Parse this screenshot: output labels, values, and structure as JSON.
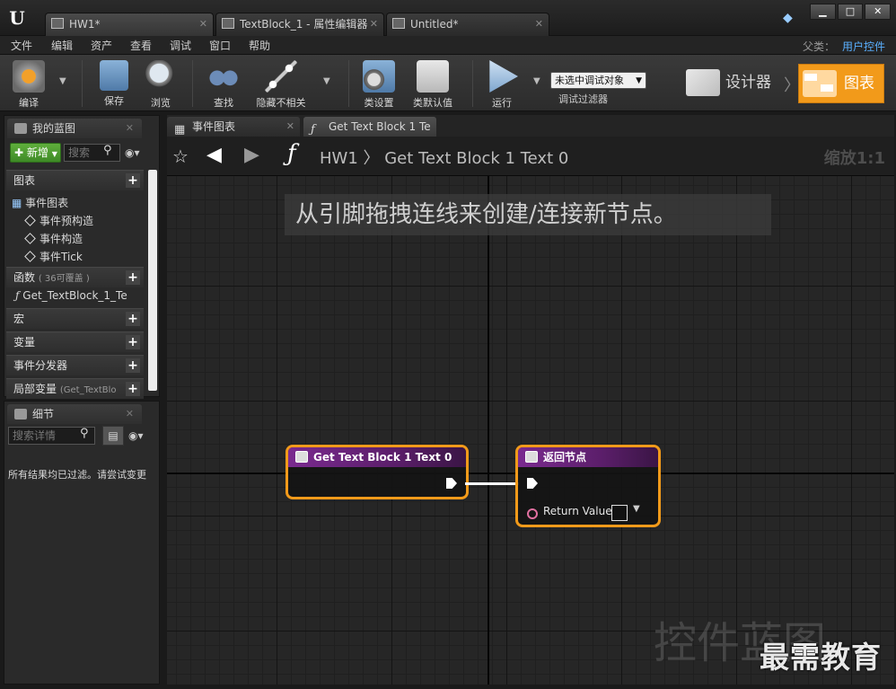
{
  "window": {
    "tabs": [
      {
        "label": "HW1*"
      },
      {
        "label": "TextBlock_1 - 属性编辑器"
      },
      {
        "label": "Untitled*"
      }
    ],
    "controls": {
      "minimize": "▁",
      "maximize": "□",
      "close": "✕"
    }
  },
  "menu": {
    "items": [
      "文件",
      "编辑",
      "资产",
      "查看",
      "调试",
      "窗口",
      "帮助"
    ],
    "parent_class_label": "父类：",
    "parent_class_value": "用户控件"
  },
  "toolbar": {
    "compile": "编译",
    "save": "保存",
    "browse": "浏览",
    "find": "查找",
    "hide_unrelated": "隐藏不相关",
    "class_settings": "类设置",
    "class_defaults": "类默认值",
    "run": "运行",
    "debug_filter_value": "未选中调试对象",
    "debug_filter_label": "调试过滤器",
    "designer": "设计器",
    "graph": "图表"
  },
  "my_blueprint": {
    "tab": "我的蓝图",
    "add_new": "新增",
    "search_placeholder": "搜索",
    "categories": {
      "graphs": "图表",
      "event_graph": "事件图表",
      "event_items": [
        "事件预构造",
        "事件构造",
        "事件Tick"
      ],
      "functions": "函数",
      "functions_note": "( 36可覆盖 )",
      "function_item": "Get_TextBlock_1_Te",
      "macros": "宏",
      "variables": "变量",
      "dispatchers": "事件分发器",
      "local_vars": "局部变量",
      "local_vars_note": "(Get_TextBlo"
    }
  },
  "details": {
    "tab": "细节",
    "search_placeholder": "搜索详情",
    "message": "所有结果均已过滤。请尝试变更"
  },
  "graph": {
    "tabs": [
      {
        "label": "事件图表"
      },
      {
        "label": "Get Text Block 1 Te"
      }
    ],
    "breadcrumb": "HW1 〉 Get Text Block 1 Text 0",
    "zoom": "缩放1:1",
    "hint": "从引脚拖拽连线来创建/连接新节点。",
    "nodes": {
      "entry_title": "Get Text Block 1 Text 0",
      "return_title": "返回节点",
      "return_pin_label": "Return Value"
    },
    "watermark": "控件蓝图"
  },
  "brand_watermark": "最需教育",
  "colors": {
    "accent": "#f29a1a",
    "node_header": "#7a2a8f",
    "link": "#5ab0ff"
  }
}
